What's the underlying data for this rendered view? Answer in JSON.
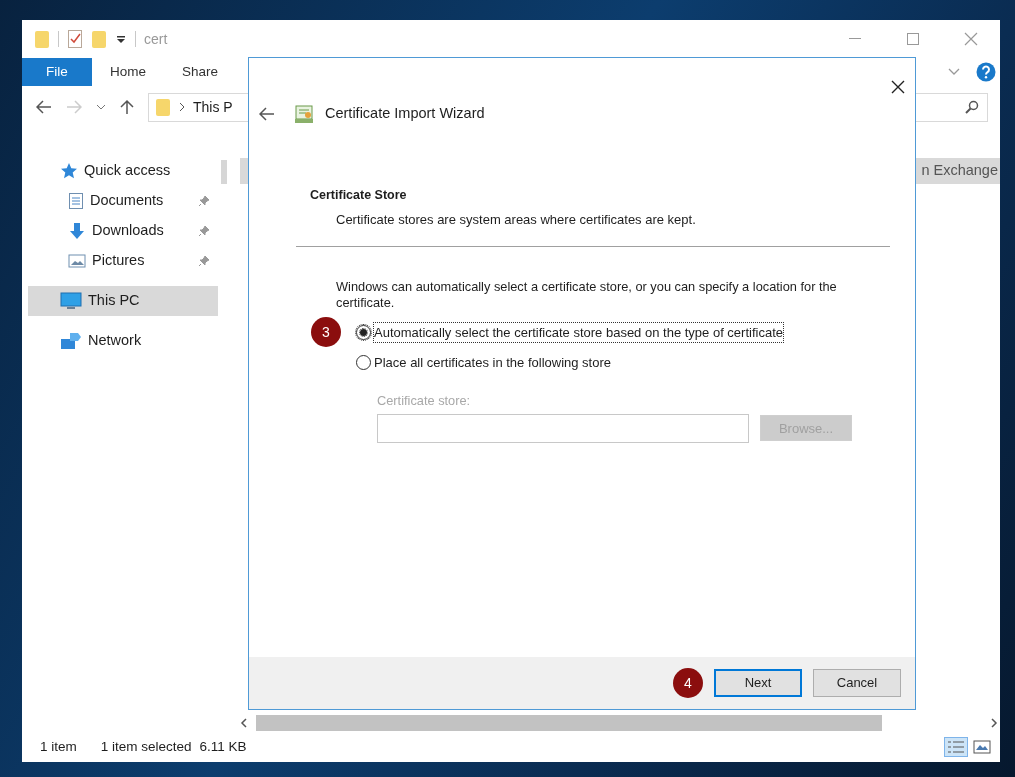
{
  "explorer": {
    "title": "cert",
    "ribbon_tabs": [
      {
        "label": "File",
        "kind": "file"
      },
      {
        "label": "Home",
        "kind": "tab"
      },
      {
        "label": "Share",
        "kind": "tab"
      }
    ],
    "address": {
      "path": "This P"
    },
    "nav": [
      {
        "label": "Quick access",
        "kind": "star",
        "selected": false,
        "children": [
          {
            "label": "Documents",
            "kind": "document",
            "selected": false,
            "pinned": true
          },
          {
            "label": "Downloads",
            "kind": "download",
            "selected": false,
            "pinned": true
          },
          {
            "label": "Pictures",
            "kind": "pictures",
            "selected": false,
            "pinned": true
          }
        ]
      },
      {
        "label": "This PC",
        "kind": "pc",
        "selected": true
      },
      {
        "label": "Network",
        "kind": "network",
        "selected": false
      }
    ],
    "file_row": {
      "label": "n Exchange",
      "selected": true
    },
    "status": [
      "1 item",
      "1 item selected",
      "6.11 KB"
    ]
  },
  "dialog": {
    "title": "Certificate Import Wizard",
    "section_title": "Certificate Store",
    "section_description": "Certificate stores are system areas where certificates are kept.",
    "prompt": "Windows can automatically select a certificate store, or you can specify a location for the certificate.",
    "options": [
      {
        "label": "Automatically select the certificate store based on the type of certificate",
        "selected": true,
        "callout": "3"
      },
      {
        "label": "Place all certificates in the following store",
        "selected": false
      }
    ],
    "store": {
      "label": "Certificate store:",
      "disabled": true
    },
    "browse": {
      "label": "Browse...",
      "disabled": true
    },
    "buttons": [
      {
        "label": "Next",
        "default": true,
        "callout": "4"
      },
      {
        "label": "Cancel",
        "default": false
      }
    ]
  }
}
